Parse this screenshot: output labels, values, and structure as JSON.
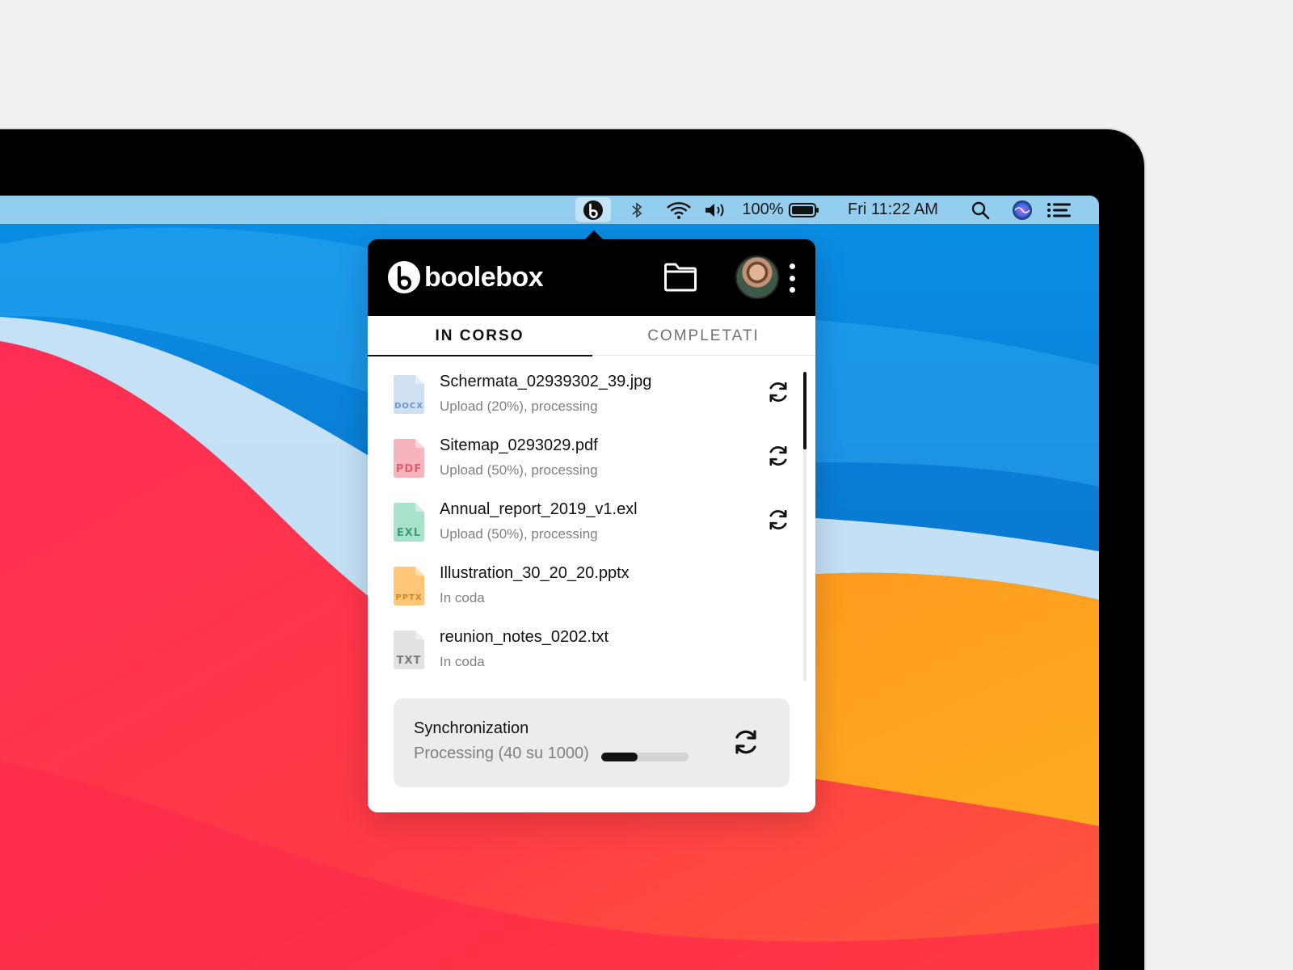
{
  "menubar": {
    "battery_percent": "100%",
    "clock": "Fri 11:22 AM",
    "icons": [
      "boolebox-icon",
      "bluetooth-icon",
      "wifi-icon",
      "volume-icon",
      "battery-icon",
      "spotlight-search-icon",
      "siri-icon",
      "control-center-icon"
    ]
  },
  "app": {
    "brand": "boolebox",
    "tabs": [
      {
        "label": "IN CORSO",
        "active": true
      },
      {
        "label": "COMPLETATI",
        "active": false
      }
    ],
    "files": [
      {
        "name": "Schermata_02939302_39.jpg",
        "status": "Upload (20%), processing",
        "type": "DOCX",
        "color": "#cfe0f3",
        "label_color": "#6f96c4",
        "syncing": true
      },
      {
        "name": "Sitemap_0293029.pdf",
        "status": "Upload (50%), processing",
        "type": "PDF",
        "color": "#f6b5bd",
        "label_color": "#e25d6e",
        "syncing": true
      },
      {
        "name": "Annual_report_2019_v1.exl",
        "status": "Upload (50%), processing",
        "type": "EXL",
        "color": "#a9e2cb",
        "label_color": "#3c9e76",
        "syncing": true
      },
      {
        "name": "Illustration_30_20_20.pptx",
        "status": "In coda",
        "type": "PPTX",
        "color": "#ffc678",
        "label_color": "#d48a2a",
        "syncing": false
      },
      {
        "name": "reunion_notes_0202.txt",
        "status": "In  coda",
        "type": "TXT",
        "color": "#e2e2e2",
        "label_color": "#7a7a7a",
        "syncing": false
      }
    ],
    "sync": {
      "title": "Synchronization",
      "status": "Processing (40 su 1000)",
      "progress": 0.42
    }
  },
  "colors": {
    "popover_header": "#000000",
    "menubar": "#a0d4f0",
    "card_bg": "#ececec"
  }
}
